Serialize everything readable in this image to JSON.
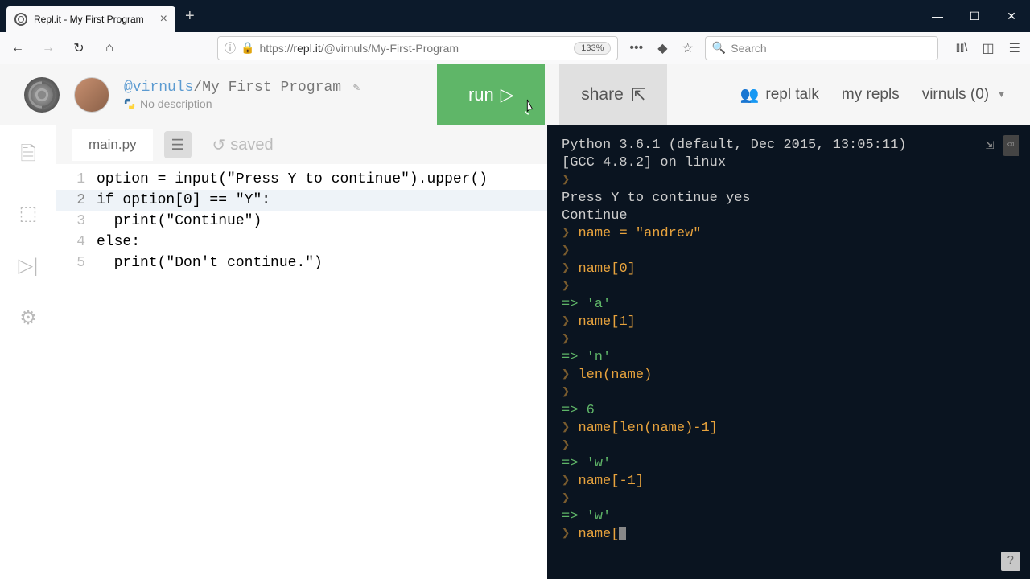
{
  "browser": {
    "tab_title": "Repl.it - My First Program",
    "url_prefix": "https://",
    "url_domain": "repl.it",
    "url_path": "/@virnuls/My-First-Program",
    "zoom": "133%",
    "search_placeholder": "Search"
  },
  "header": {
    "user": "@virnuls",
    "separator": "/",
    "project": "My First Program",
    "description": "No description",
    "run_label": "run",
    "share_label": "share",
    "repl_talk": "repl talk",
    "my_repls": "my repls",
    "account": "virnuls (0)"
  },
  "editor": {
    "filename": "main.py",
    "saved_label": "saved",
    "lines": [
      "option = input(\"Press Y to continue\").upper()",
      "if option[0] == \"Y\":",
      "  print(\"Continue\")",
      "else:",
      "  print(\"Don't continue.\")"
    ],
    "line_numbers": [
      "1",
      "2",
      "3",
      "4",
      "5"
    ]
  },
  "console": {
    "banner1": "Python 3.6.1 (default, Dec 2015, 13:05:11)",
    "banner2": "[GCC 4.8.2] on linux",
    "io": [
      {
        "type": "prompt",
        "text": ""
      },
      {
        "type": "plain",
        "text": "Press Y to continue yes"
      },
      {
        "type": "plain",
        "text": "Continue"
      },
      {
        "type": "input",
        "text": "name = \"andrew\""
      },
      {
        "type": "prompt",
        "text": ""
      },
      {
        "type": "input",
        "text": "name[0]"
      },
      {
        "type": "prompt",
        "text": ""
      },
      {
        "type": "result",
        "text": "'a'"
      },
      {
        "type": "input",
        "text": "name[1]"
      },
      {
        "type": "prompt",
        "text": ""
      },
      {
        "type": "result",
        "text": "'n'"
      },
      {
        "type": "input",
        "text": "len(name)"
      },
      {
        "type": "prompt",
        "text": ""
      },
      {
        "type": "result",
        "text": "6"
      },
      {
        "type": "input",
        "text": "name[len(name)-1]"
      },
      {
        "type": "prompt",
        "text": ""
      },
      {
        "type": "result",
        "text": "'w'"
      },
      {
        "type": "input",
        "text": "name[-1]"
      },
      {
        "type": "prompt",
        "text": ""
      },
      {
        "type": "result",
        "text": "'w'"
      },
      {
        "type": "input-cursor",
        "text": "name["
      }
    ]
  },
  "help": "?"
}
